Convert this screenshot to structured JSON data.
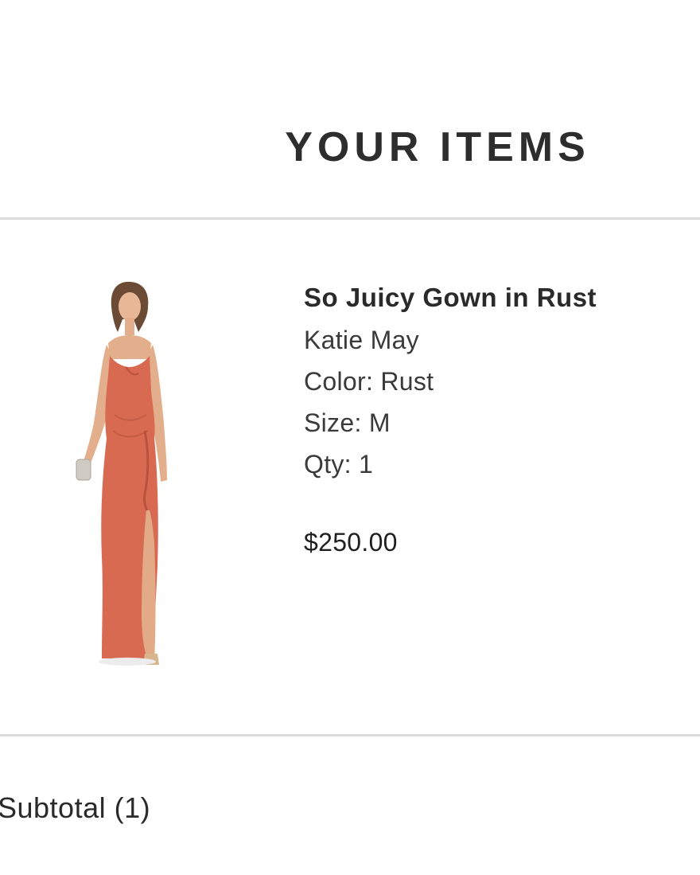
{
  "header": {
    "title": "YOUR ITEMS"
  },
  "cart": {
    "items": [
      {
        "name": "So Juicy Gown in Rust",
        "brand": "Katie May",
        "color": "Color: Rust",
        "size": "Size: M",
        "qty": "Qty: 1",
        "price": "$250.00",
        "image_icon": "product-photo-rust-gown",
        "dress_color": "#d96a52"
      }
    ]
  },
  "summary": {
    "subtotal_label": "Subtotal (1)"
  }
}
